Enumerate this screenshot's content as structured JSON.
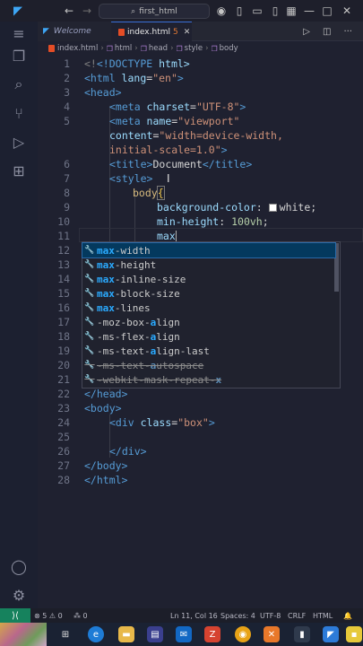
{
  "titlebar": {
    "app_icon": "vscode-logo-icon",
    "search_text": "first_html"
  },
  "tabs": [
    {
      "label": "Welcome"
    },
    {
      "label": "index.html",
      "badge": "5"
    }
  ],
  "breadcrumb": [
    "index.html",
    "html",
    "head",
    "style",
    "body"
  ],
  "editor": {
    "line_numbers": [
      "1",
      "2",
      "3",
      "4",
      "5",
      "",
      "",
      "6",
      "7",
      "8",
      "9",
      "10",
      "11",
      "12",
      "13",
      "14",
      "15",
      "16",
      "17",
      "18",
      "19",
      "20",
      "21",
      "22",
      "23",
      "24",
      "25",
      "26",
      "27",
      "28"
    ],
    "code": {
      "l1a": "<!DOCTYPE",
      "l1b": " html>",
      "l2a": "<html",
      "l2b": " lang",
      "l2c": "=",
      "l2d": "\"en\"",
      "l2e": ">",
      "l3": "<head>",
      "l4a": "<meta",
      "l4b": " charset",
      "l4c": "=",
      "l4d": "\"UTF-8\"",
      "l4e": ">",
      "l5a": "<meta",
      "l5b": " name",
      "l5c": "=",
      "l5d": "\"viewport\"",
      "l5e": "content",
      "l5f": "=",
      "l5g": "\"width=device-width,",
      "l5h": "initial-scale=1.0\"",
      "l5i": ">",
      "l6a": "<title>",
      "l6b": "Document",
      "l6c": "</title>",
      "l7": "<style>",
      "l8a": "body",
      "l8b": "{",
      "l9a": "background-color",
      "l9b": ": ",
      "l9c": "white",
      "l9d": ";",
      "l10a": "min-height",
      "l10b": ": ",
      "l10c": "100vh",
      "l10d": ";",
      "l11": "max",
      "l22": "</head>",
      "l23": "<body>",
      "l24a": "<div",
      "l24b": " class",
      "l24c": "=",
      "l24d": "\"box\"",
      "l24e": ">",
      "l26": "</div>",
      "l27": "</body>",
      "l28": "</html>"
    }
  },
  "suggestions": [
    {
      "match": "max",
      "rest": "-width",
      "pre": ""
    },
    {
      "match": "max",
      "rest": "-height",
      "pre": ""
    },
    {
      "match": "max",
      "rest": "-inline-size",
      "pre": ""
    },
    {
      "match": "max",
      "rest": "-block-size",
      "pre": ""
    },
    {
      "match": "max",
      "rest": "-lines",
      "pre": ""
    },
    {
      "pre": "-moz-box-",
      "match": "a",
      "rest": "lign"
    },
    {
      "pre": "-ms-flex-",
      "match": "a",
      "rest": "lign"
    },
    {
      "pre": "-ms-text-",
      "match": "a",
      "rest": "lign-last"
    },
    {
      "pre": "-ms-text-",
      "match": "a",
      "rest": "utospace"
    },
    {
      "pre": "-webkit-mask-repeat-",
      "match": "x",
      "rest": ""
    }
  ],
  "status": {
    "errors": "5",
    "warnings": "0",
    "infos": "0",
    "position": "Ln 11, Col 16",
    "spaces": "Spaces: 4",
    "encoding": "UTF-8",
    "eol": "CRLF",
    "language": "HTML"
  },
  "colors": {
    "accent": "#2aaaff",
    "remote": "#16825d",
    "tag": "#569cd6",
    "string": "#ce9178"
  }
}
